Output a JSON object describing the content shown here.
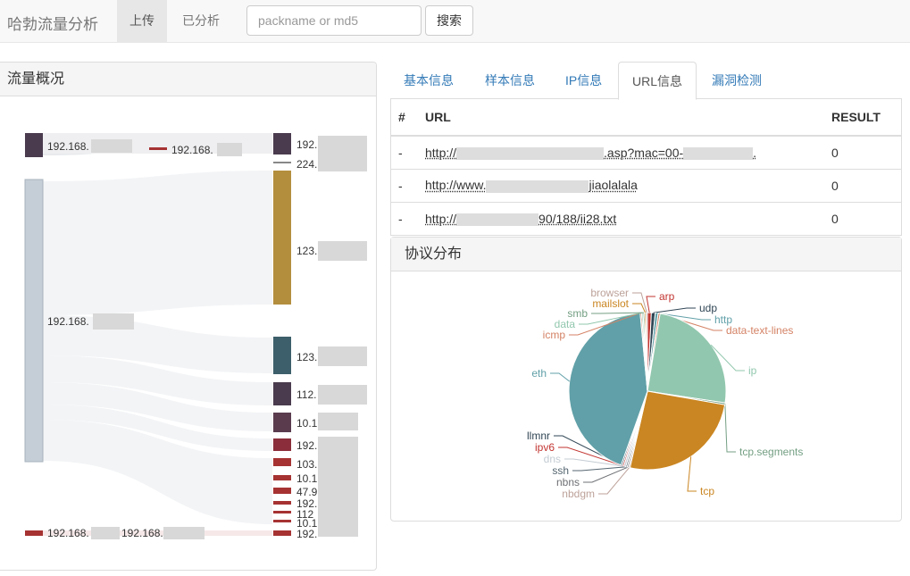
{
  "navbar": {
    "brand": "哈勃流量分析",
    "items": [
      {
        "label": "上传",
        "active": true
      },
      {
        "label": "已分析",
        "active": false
      }
    ],
    "search_placeholder": "packname or md5",
    "search_button": "搜索"
  },
  "traffic_panel": {
    "title": "流量概况",
    "source_nodes": [
      {
        "label": "192.168.",
        "color": "#4a3b4e"
      },
      {
        "label": "192.168.",
        "color": "#c5ced6"
      },
      {
        "label": "192.168.",
        "color": "#a63232"
      }
    ],
    "middle_nodes": [
      {
        "label": "192.168.",
        "color": "#a63232"
      },
      {
        "label": "192.168.",
        "color": "#a63232"
      }
    ],
    "target_nodes": [
      {
        "label": "192.",
        "color": "#4a3b4e"
      },
      {
        "label": "224.",
        "color": "#cccccc"
      },
      {
        "label": "123.",
        "color": "#b38e3d"
      },
      {
        "label": "123.",
        "color": "#3d5f6b"
      },
      {
        "label": "112.",
        "color": "#4a3b4e"
      },
      {
        "label": "10.1",
        "color": "#5a3b4e"
      },
      {
        "label": "192.",
        "color": "#8b2d3a"
      },
      {
        "label": "103.",
        "color": "#a63232"
      },
      {
        "label": "10.1",
        "color": "#a63232"
      },
      {
        "label": "47.9",
        "color": "#a63232"
      },
      {
        "label": "192.",
        "color": "#a63232"
      },
      {
        "label": "112",
        "color": "#a63232"
      },
      {
        "label": "10.1",
        "color": "#a63232"
      },
      {
        "label": "192.",
        "color": "#a63232"
      }
    ]
  },
  "tabs": [
    {
      "label": "基本信息",
      "active": false
    },
    {
      "label": "样本信息",
      "active": false
    },
    {
      "label": "IP信息",
      "active": false
    },
    {
      "label": "URL信息",
      "active": true
    },
    {
      "label": "漏洞检测",
      "active": false
    }
  ],
  "url_table": {
    "headers": [
      "#",
      "URL",
      "RESULT"
    ],
    "rows": [
      {
        "index": "-",
        "url_prefix": "http://",
        "url_suffix": ".asp?mac=00-",
        "result": "0"
      },
      {
        "index": "-",
        "url_prefix": "http://www.",
        "url_suffix": "jiaolalala",
        "result": "0"
      },
      {
        "index": "-",
        "url_prefix": "http://",
        "url_suffix": "90/188/ii28.txt",
        "result": "0"
      }
    ]
  },
  "protocol_panel": {
    "title": "协议分布"
  },
  "chart_data": {
    "type": "pie",
    "title": "",
    "slices": [
      {
        "name": "arp",
        "value": 0.8,
        "color": "#c23531"
      },
      {
        "name": "udp",
        "value": 0.8,
        "color": "#2f4554"
      },
      {
        "name": "http",
        "value": 0.6,
        "color": "#61a0a8"
      },
      {
        "name": "data-text-lines",
        "value": 0.4,
        "color": "#d48265"
      },
      {
        "name": "ip",
        "value": 25.0,
        "color": "#91c7ae"
      },
      {
        "name": "tcp.segments",
        "value": 0.4,
        "color": "#749f83"
      },
      {
        "name": "tcp",
        "value": 26.0,
        "color": "#ca8622"
      },
      {
        "name": "nbdgm",
        "value": 0.3,
        "color": "#bda29a"
      },
      {
        "name": "nbns",
        "value": 0.3,
        "color": "#6e7074"
      },
      {
        "name": "ssh",
        "value": 0.3,
        "color": "#546570"
      },
      {
        "name": "dns",
        "value": 0.4,
        "color": "#c4ccd3"
      },
      {
        "name": "ipv6",
        "value": 0.3,
        "color": "#c23531"
      },
      {
        "name": "llmnr",
        "value": 0.3,
        "color": "#2f4554"
      },
      {
        "name": "eth",
        "value": 43.4,
        "color": "#61a0a8"
      },
      {
        "name": "icmp",
        "value": 0.3,
        "color": "#d48265"
      },
      {
        "name": "data",
        "value": 0.3,
        "color": "#91c7ae"
      },
      {
        "name": "smb",
        "value": 0.3,
        "color": "#749f83"
      },
      {
        "name": "mailslot",
        "value": 0.3,
        "color": "#ca8622"
      },
      {
        "name": "browser",
        "value": 0.3,
        "color": "#bda29a"
      }
    ]
  }
}
